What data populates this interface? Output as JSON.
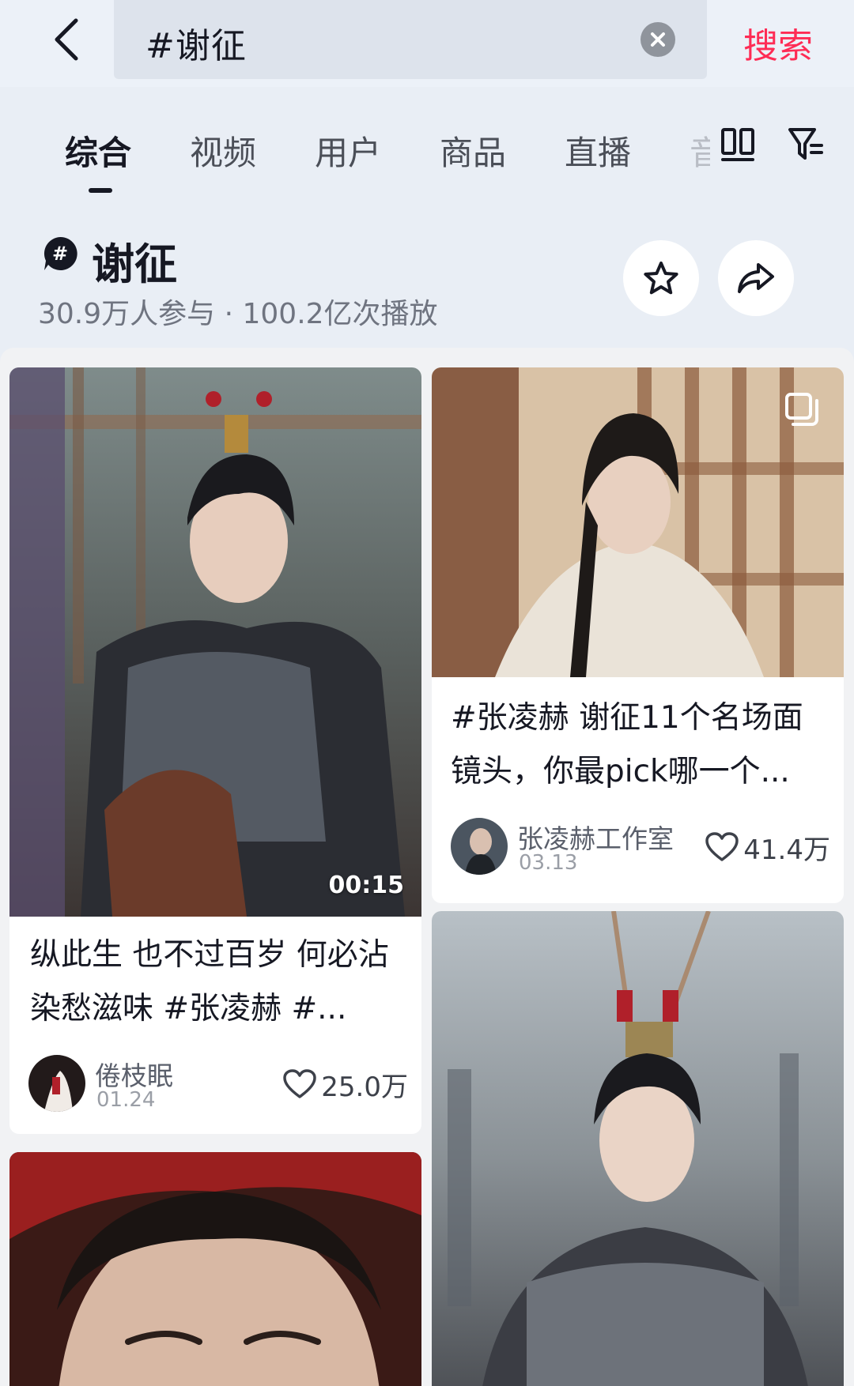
{
  "search": {
    "query": "#谢征",
    "submit_label": "搜索"
  },
  "tabs": [
    {
      "label": "综合",
      "active": true
    },
    {
      "label": "视频",
      "active": false
    },
    {
      "label": "用户",
      "active": false
    },
    {
      "label": "商品",
      "active": false
    },
    {
      "label": "直播",
      "active": false
    },
    {
      "label": "音",
      "active": false
    }
  ],
  "topic": {
    "title": "谢征",
    "stats": "30.9万人参与 · 100.2亿次播放"
  },
  "cards": [
    {
      "duration": "00:15",
      "title": "纵此生 也不过百岁 何必沾染愁滋味 #张凌赫 #...",
      "author": "倦枝眠",
      "date": "01.24",
      "likes": "25.0万"
    },
    {
      "title": "#张凌赫 谢征11个名场面镜头，你最pick哪一个...",
      "author": "张凌赫工作室",
      "date": "03.13",
      "likes": "41.4万"
    },
    {
      "title": ""
    },
    {
      "title": ""
    }
  ],
  "icons": {
    "back": "chevron-left-icon",
    "clear": "close-circle-icon",
    "layout": "double-column-icon",
    "filter": "filter-icon",
    "topic": "hashtag-icon",
    "favorite": "star-icon",
    "share": "share-arrow-icon",
    "like": "heart-icon",
    "multi": "multi-image-icon"
  },
  "colors": {
    "accent": "#fe2c55",
    "background": "#e9eef5",
    "text": "#161823"
  }
}
